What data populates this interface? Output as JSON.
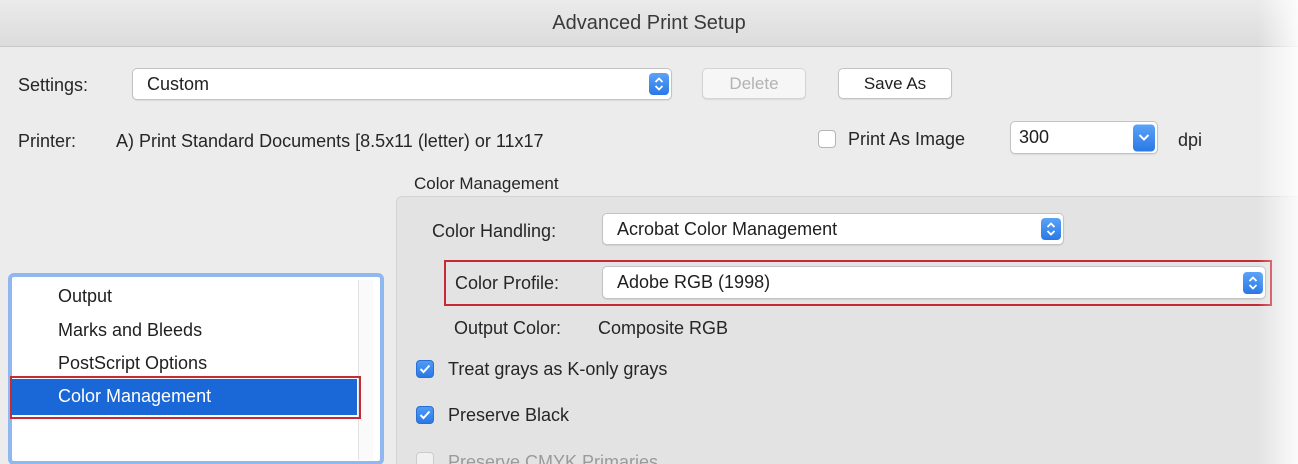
{
  "window": {
    "title": "Advanced Print Setup"
  },
  "settings": {
    "label": "Settings:",
    "value": "Custom",
    "delete_label": "Delete",
    "save_as_label": "Save As"
  },
  "printer": {
    "label": "Printer:",
    "value": "A) Print Standard Documents [8.5x11 (letter) or 11x17"
  },
  "print_as_image": {
    "label": "Print As Image",
    "checked": false,
    "dpi_value": "300",
    "dpi_unit": "dpi"
  },
  "section": {
    "title": "Color Management"
  },
  "color_handling": {
    "label": "Color Handling:",
    "value": "Acrobat Color Management"
  },
  "color_profile": {
    "label": "Color Profile:",
    "value": "Adobe RGB (1998)"
  },
  "output_color": {
    "label": "Output Color:",
    "value": "Composite RGB"
  },
  "options": [
    {
      "label": "Treat grays as K-only grays",
      "checked": true
    },
    {
      "label": "Preserve Black",
      "checked": true
    },
    {
      "label": "Preserve CMYK Primaries",
      "checked": false
    }
  ],
  "sidebar": {
    "items": [
      {
        "label": "Output",
        "selected": false
      },
      {
        "label": "Marks and Bleeds",
        "selected": false
      },
      {
        "label": "PostScript Options",
        "selected": false
      },
      {
        "label": "Color Management",
        "selected": true
      }
    ]
  },
  "colors": {
    "accent": "#1a68d8",
    "highlight_box": "#c42b36",
    "checkbox_blue": "#2a78e6"
  },
  "icons": {
    "popup_stepper": "updown-chevron-icon",
    "dropdown": "chevron-down-icon",
    "checkmark": "checkmark-icon"
  }
}
